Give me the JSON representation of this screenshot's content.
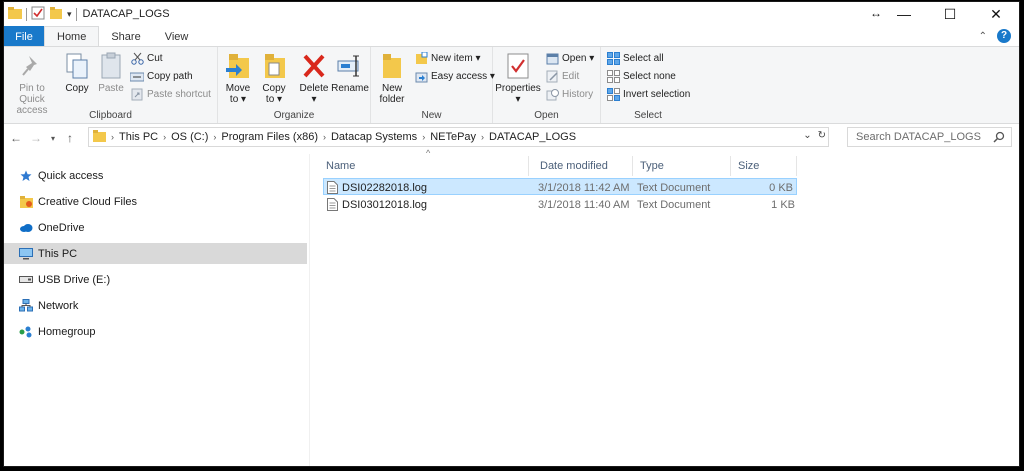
{
  "window": {
    "title": "DATACAP_LOGS",
    "controls": {
      "minimize": "—",
      "maximize": "☐",
      "close": "✕"
    }
  },
  "ribbon_tabs": [
    "File",
    "Home",
    "Share",
    "View"
  ],
  "ribbon": {
    "clipboard": {
      "label": "Clipboard",
      "pin_to_quick_access": [
        "Pin to Quick",
        "access"
      ],
      "copy": "Copy",
      "paste": "Paste",
      "cut": "Cut",
      "copy_path": "Copy path",
      "paste_shortcut": "Paste shortcut"
    },
    "organize": {
      "label": "Organize",
      "move_to": [
        "Move",
        "to ▾"
      ],
      "copy_to": [
        "Copy",
        "to ▾"
      ],
      "delete": [
        "Delete",
        "▾"
      ],
      "rename": "Rename"
    },
    "new": {
      "label": "New",
      "new_folder": [
        "New",
        "folder"
      ],
      "new_item": "New item ▾",
      "easy_access": "Easy access ▾"
    },
    "open": {
      "label": "Open",
      "properties": [
        "Properties",
        "▾"
      ],
      "open": "Open ▾",
      "edit": "Edit",
      "history": "History"
    },
    "select": {
      "label": "Select",
      "select_all": "Select all",
      "select_none": "Select none",
      "invert_selection": "Invert selection"
    }
  },
  "address": {
    "breadcrumb": [
      "This PC",
      "OS (C:)",
      "Program Files (x86)",
      "Datacap Systems",
      "NETePay",
      "DATACAP_LOGS"
    ],
    "search_placeholder": "Search DATACAP_LOGS"
  },
  "nav_pane": [
    {
      "label": "Quick access",
      "icon": "star-icon",
      "color": "#2f7ad1"
    },
    {
      "label": "Creative Cloud Files",
      "icon": "creative-cloud-folder-icon",
      "color": "#e87522"
    },
    {
      "label": "OneDrive",
      "icon": "onedrive-cloud-icon",
      "color": "#0f6ec7"
    },
    {
      "label": "This PC",
      "icon": "computer-icon",
      "color": "#2b8ad6",
      "selected": true
    },
    {
      "label": "USB Drive (E:)",
      "icon": "usb-drive-icon",
      "color": "#555555"
    },
    {
      "label": "Network",
      "icon": "network-icon",
      "color": "#2b8ad6"
    },
    {
      "label": "Homegroup",
      "icon": "homegroup-icon",
      "color": "#2a9d4a"
    }
  ],
  "columns": {
    "name": "Name",
    "date_modified": "Date modified",
    "type": "Type",
    "size": "Size"
  },
  "files": [
    {
      "name": "DSI02282018.log",
      "date": "3/1/2018 11:42 AM",
      "type": "Text Document",
      "size": "0 KB",
      "selected": true
    },
    {
      "name": "DSI03012018.log",
      "date": "3/1/2018 11:40 AM",
      "type": "Text Document",
      "size": "1 KB",
      "selected": false
    }
  ],
  "colors": {
    "accent": "#1979ca",
    "selection": "#cce8ff",
    "nav_selected": "#d9d9d9"
  }
}
